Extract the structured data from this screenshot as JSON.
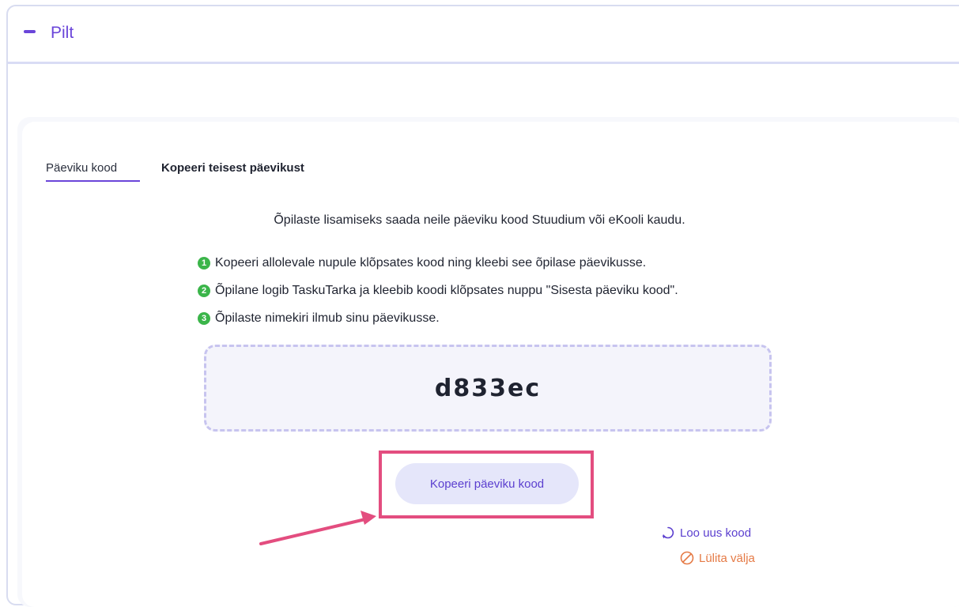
{
  "header": {
    "title": "Pilt",
    "collapse_icon": "minus-icon"
  },
  "tabs": [
    {
      "label": "Päeviku kood",
      "active": true
    },
    {
      "label": "Kopeeri teisest päevikust",
      "active": false
    }
  ],
  "intro": "Õpilaste lisamiseks saada neile päeviku kood Stuudium või eKooli kaudu.",
  "steps": [
    {
      "num": "1",
      "text": "Kopeeri allolevale nupule klõpsates kood ning kleebi see õpilase päevikusse."
    },
    {
      "num": "2",
      "text": "Õpilane logib TaskuTarka ja kleebib koodi klõpsates nuppu \"Sisesta päeviku kood\"."
    },
    {
      "num": "3",
      "text": "Õpilaste nimekiri ilmub sinu päevikusse."
    }
  ],
  "code": "d833ec",
  "copy_button": "Kopeeri päeviku kood",
  "links": {
    "new_code": "Loo uus kood",
    "switch_off": "Lülita välja"
  },
  "colors": {
    "accent": "#6a45d9",
    "step_badge": "#3bb54a",
    "highlight": "#e34d7f",
    "warning": "#e57a45"
  }
}
